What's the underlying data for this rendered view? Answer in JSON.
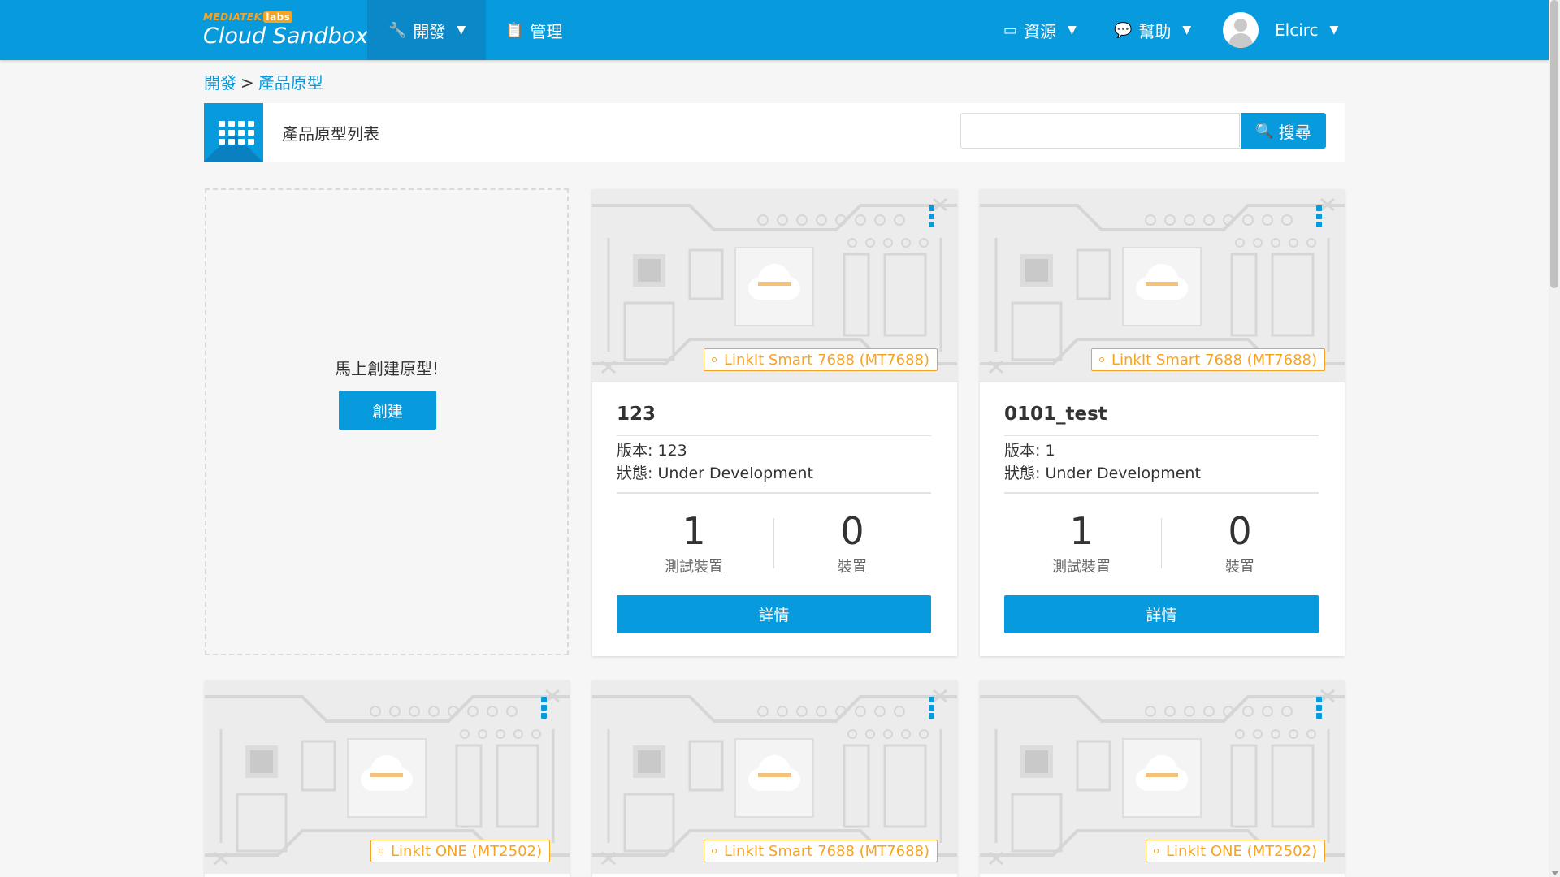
{
  "app": {
    "logo_brand": "MEDIATEK",
    "logo_labs": "labs",
    "logo_product": "Cloud Sandbox"
  },
  "nav": {
    "develop": "開發",
    "manage": "管理",
    "resources": "資源",
    "help": "幫助",
    "user": "Elcirc"
  },
  "breadcrumb": {
    "root": "開發",
    "separator": ">",
    "current": "產品原型"
  },
  "header": {
    "title": "產品原型列表",
    "search_button": "搜尋",
    "search_value": ""
  },
  "create": {
    "prompt": "馬上創建原型!",
    "button": "創建"
  },
  "cards": [
    {
      "board": "LinkIt Smart 7688 (MT7688)",
      "name": "123",
      "version_label": "版本: 123",
      "status_label": "狀態: Under Development",
      "test_devices": "1",
      "test_devices_label": "測試裝置",
      "devices": "0",
      "devices_label": "裝置",
      "detail_button": "詳情"
    },
    {
      "board": "LinkIt Smart 7688 (MT7688)",
      "name": "0101_test",
      "version_label": "版本: 1",
      "status_label": "狀態: Under Development",
      "test_devices": "1",
      "test_devices_label": "測試裝置",
      "devices": "0",
      "devices_label": "裝置",
      "detail_button": "詳情"
    },
    {
      "board": "LinkIt ONE (MT2502)"
    },
    {
      "board": "LinkIt Smart 7688 (MT7688)"
    },
    {
      "board": "LinkIt ONE (MT2502)"
    }
  ],
  "colors": {
    "primary": "#079bde",
    "accent": "#f6a323",
    "background": "#f6f6f6"
  },
  "icons": {
    "develop": "wrench-icon",
    "manage": "clipboard-icon",
    "resources": "inbox-icon",
    "help": "chat-icon",
    "search": "search-icon",
    "grid": "grid-icon",
    "card_menu": "vertical-dots-icon"
  }
}
